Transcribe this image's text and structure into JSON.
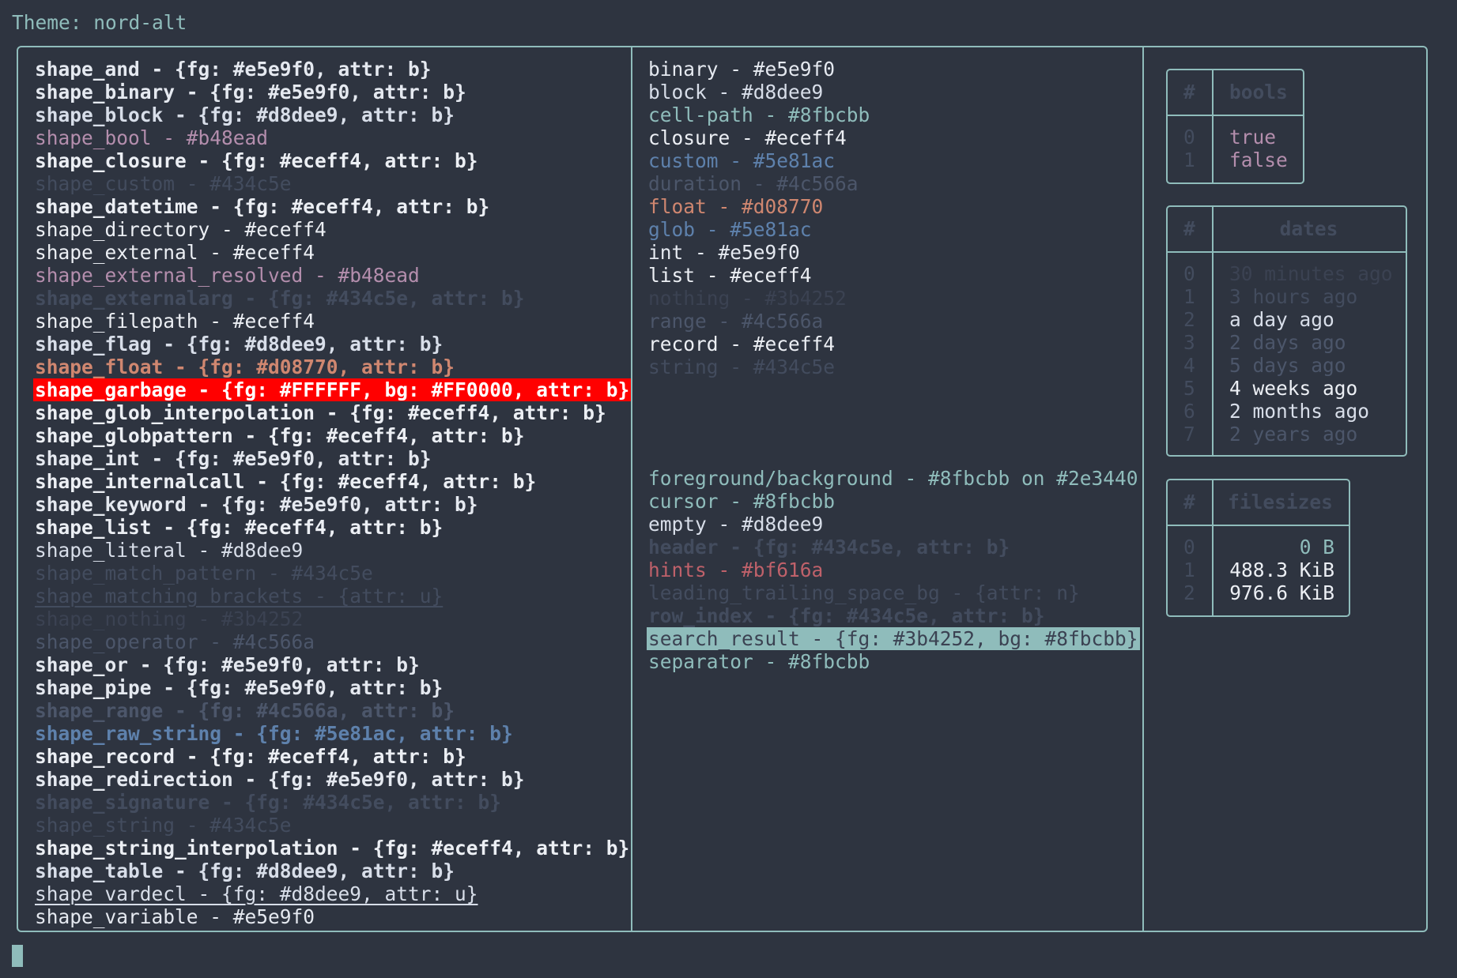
{
  "header": {
    "title": "Theme: nord-alt"
  },
  "shapes": [
    {
      "text": "shape_and - {fg: #e5e9f0, attr: b}",
      "color": "#e5e9f0",
      "bold": true
    },
    {
      "text": "shape_binary - {fg: #e5e9f0, attr: b}",
      "color": "#e5e9f0",
      "bold": true
    },
    {
      "text": "shape_block - {fg: #d8dee9, attr: b}",
      "color": "#d8dee9",
      "bold": true
    },
    {
      "text": "shape_bool - #b48ead",
      "color": "#b48ead"
    },
    {
      "text": "shape_closure - {fg: #eceff4, attr: b}",
      "color": "#eceff4",
      "bold": true
    },
    {
      "text": "shape_custom - #434c5e",
      "color": "#434c5e"
    },
    {
      "text": "shape_datetime - {fg: #eceff4, attr: b}",
      "color": "#eceff4",
      "bold": true
    },
    {
      "text": "shape_directory - #eceff4",
      "color": "#eceff4"
    },
    {
      "text": "shape_external - #eceff4",
      "color": "#eceff4"
    },
    {
      "text": "shape_external_resolved - #b48ead",
      "color": "#b48ead"
    },
    {
      "text": "shape_externalarg - {fg: #434c5e, attr: b}",
      "color": "#434c5e",
      "bold": true
    },
    {
      "text": "shape_filepath - #eceff4",
      "color": "#eceff4"
    },
    {
      "text": "shape_flag - {fg: #d8dee9, attr: b}",
      "color": "#d8dee9",
      "bold": true
    },
    {
      "text": "shape_float - {fg: #d08770, attr: b}",
      "color": "#d08770",
      "bold": true
    },
    {
      "text": "shape_garbage - {fg: #FFFFFF, bg: #FF0000, attr: b}",
      "color": "#FFFFFF",
      "bg": "#FF0000",
      "bold": true
    },
    {
      "text": "shape_glob_interpolation - {fg: #eceff4, attr: b}",
      "color": "#eceff4",
      "bold": true
    },
    {
      "text": "shape_globpattern - {fg: #eceff4, attr: b}",
      "color": "#eceff4",
      "bold": true
    },
    {
      "text": "shape_int - {fg: #e5e9f0, attr: b}",
      "color": "#e5e9f0",
      "bold": true
    },
    {
      "text": "shape_internalcall - {fg: #eceff4, attr: b}",
      "color": "#eceff4",
      "bold": true
    },
    {
      "text": "shape_keyword - {fg: #e5e9f0, attr: b}",
      "color": "#e5e9f0",
      "bold": true
    },
    {
      "text": "shape_list - {fg: #eceff4, attr: b}",
      "color": "#eceff4",
      "bold": true
    },
    {
      "text": "shape_literal - #d8dee9",
      "color": "#d8dee9"
    },
    {
      "text": "shape_match_pattern - #434c5e",
      "color": "#434c5e"
    },
    {
      "text": "shape_matching_brackets - {attr: u}",
      "color": "#434c5e",
      "underline": true
    },
    {
      "text": "shape_nothing - #3b4252",
      "color": "#3b4252"
    },
    {
      "text": "shape_operator - #4c566a",
      "color": "#4c566a"
    },
    {
      "text": "shape_or - {fg: #e5e9f0, attr: b}",
      "color": "#e5e9f0",
      "bold": true
    },
    {
      "text": "shape_pipe - {fg: #e5e9f0, attr: b}",
      "color": "#e5e9f0",
      "bold": true
    },
    {
      "text": "shape_range - {fg: #4c566a, attr: b}",
      "color": "#4c566a",
      "bold": true
    },
    {
      "text": "shape_raw_string - {fg: #5e81ac, attr: b}",
      "color": "#5e81ac",
      "bold": true
    },
    {
      "text": "shape_record - {fg: #eceff4, attr: b}",
      "color": "#eceff4",
      "bold": true
    },
    {
      "text": "shape_redirection - {fg: #e5e9f0, attr: b}",
      "color": "#e5e9f0",
      "bold": true
    },
    {
      "text": "shape_signature - {fg: #434c5e, attr: b}",
      "color": "#434c5e",
      "bold": true
    },
    {
      "text": "shape_string - #434c5e",
      "color": "#434c5e"
    },
    {
      "text": "shape_string_interpolation - {fg: #eceff4, attr: b}",
      "color": "#eceff4",
      "bold": true
    },
    {
      "text": "shape_table - {fg: #d8dee9, attr: b}",
      "color": "#d8dee9",
      "bold": true
    },
    {
      "text": "shape_vardecl - {fg: #d8dee9, attr: u}",
      "color": "#d8dee9",
      "underline": true
    },
    {
      "text": "shape_variable - #e5e9f0",
      "color": "#e5e9f0"
    }
  ],
  "types": [
    {
      "text": "binary - #e5e9f0",
      "color": "#e5e9f0"
    },
    {
      "text": "block - #d8dee9",
      "color": "#d8dee9"
    },
    {
      "text": "cell-path - #8fbcbb",
      "color": "#8fbcbb"
    },
    {
      "text": "closure - #eceff4",
      "color": "#eceff4"
    },
    {
      "text": "custom - #5e81ac",
      "color": "#5e81ac"
    },
    {
      "text": "duration - #4c566a",
      "color": "#4c566a"
    },
    {
      "text": "float - #d08770",
      "color": "#d08770"
    },
    {
      "text": "glob - #5e81ac",
      "color": "#5e81ac"
    },
    {
      "text": "int - #e5e9f0",
      "color": "#e5e9f0"
    },
    {
      "text": "list - #eceff4",
      "color": "#eceff4"
    },
    {
      "text": "nothing - #3b4252",
      "color": "#3b4252"
    },
    {
      "text": "range - #4c566a",
      "color": "#4c566a"
    },
    {
      "text": "record - #eceff4",
      "color": "#eceff4"
    },
    {
      "text": "string - #434c5e",
      "color": "#434c5e"
    }
  ],
  "ui": [
    {
      "text": "foreground/background - #8fbcbb on #2e3440",
      "color": "#8fbcbb"
    },
    {
      "text": "cursor - #8fbcbb",
      "color": "#8fbcbb"
    },
    {
      "text": "empty - #d8dee9",
      "color": "#d8dee9"
    },
    {
      "text": "header - {fg: #434c5e, attr: b}",
      "color": "#434c5e",
      "bold": true
    },
    {
      "text": "hints - #bf616a",
      "color": "#bf616a"
    },
    {
      "text": "leading_trailing_space_bg - {attr: n}",
      "color": "#434c5e"
    },
    {
      "text": "row_index - {fg: #434c5e, attr: b}",
      "color": "#434c5e",
      "bold": true
    },
    {
      "text": "search_result - {fg: #3b4252, bg: #8fbcbb}",
      "color": "#3b4252",
      "bg": "#8fbcbb"
    },
    {
      "text": "separator - #8fbcbb",
      "color": "#8fbcbb"
    }
  ],
  "bools_table": {
    "index_header": "#",
    "header": "bools",
    "rows": [
      {
        "index": "0",
        "value": "true",
        "color": "#b48ead"
      },
      {
        "index": "1",
        "value": "false",
        "color": "#b48ead"
      }
    ]
  },
  "dates_table": {
    "index_header": "#",
    "header": "dates",
    "rows": [
      {
        "index": "0",
        "value": "30 minutes ago",
        "color": "#3b4252"
      },
      {
        "index": "1",
        "value": "3 hours ago",
        "color": "#434c5e"
      },
      {
        "index": "2",
        "value": "a day ago",
        "color": "#d8dee9"
      },
      {
        "index": "3",
        "value": "2 days ago",
        "color": "#4c566a"
      },
      {
        "index": "4",
        "value": "5 days ago",
        "color": "#4c566a"
      },
      {
        "index": "5",
        "value": "4 weeks ago",
        "color": "#eceff4"
      },
      {
        "index": "6",
        "value": "2 months ago",
        "color": "#d8dee9"
      },
      {
        "index": "7",
        "value": "2 years ago",
        "color": "#4c566a"
      }
    ]
  },
  "filesizes_table": {
    "index_header": "#",
    "header": "filesizes",
    "rows": [
      {
        "index": "0",
        "value": "     0 B",
        "color": "#8fbcbb"
      },
      {
        "index": "1",
        "value": "488.3 KiB",
        "color": "#eceff4"
      },
      {
        "index": "2",
        "value": "976.6 KiB",
        "color": "#eceff4"
      }
    ]
  },
  "colors": {
    "accent": "#8fbcbb",
    "background": "#2e3440",
    "dim": "#434c5e"
  },
  "icons": {
    "cursor": "block-cursor"
  }
}
